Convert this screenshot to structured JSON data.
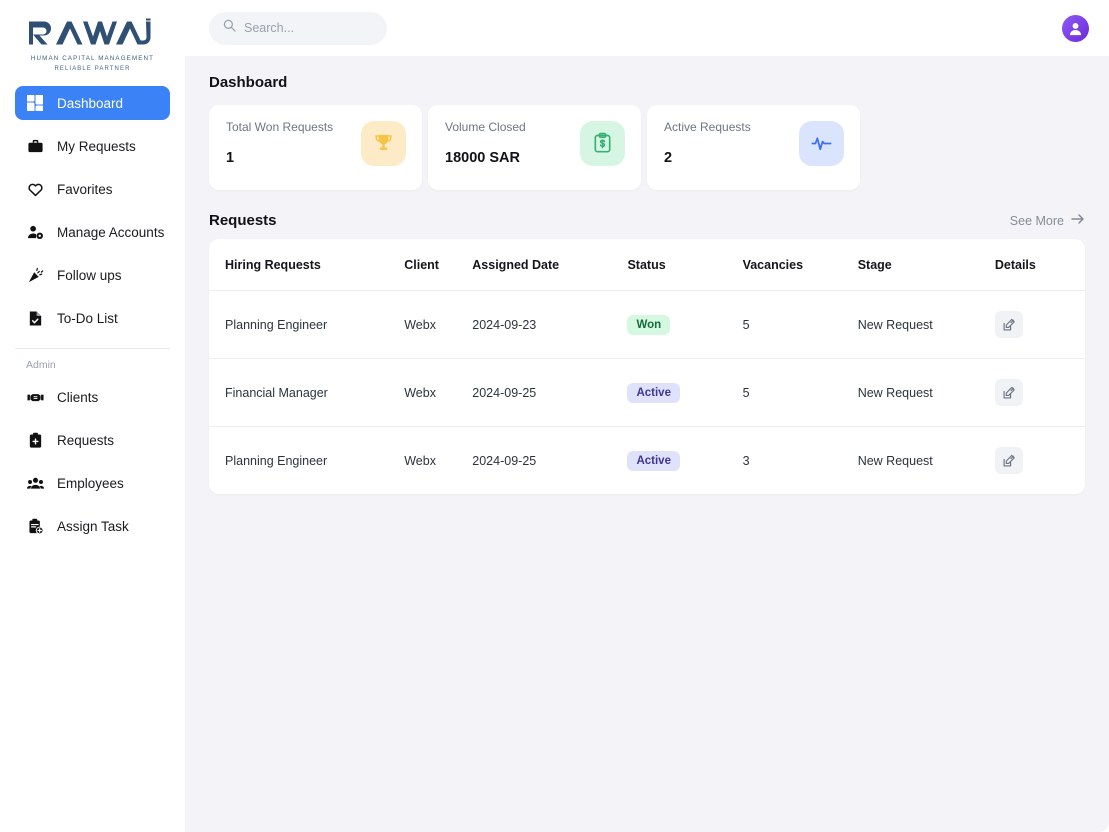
{
  "brand": {
    "name": "RAWAJ",
    "tagline_1": "HUMAN CAPITAL MANAGEMENT",
    "tagline_2": "RELIABLE PARTNER",
    "logo_color": "#2f4f73"
  },
  "topbar": {
    "search_placeholder": "Search...",
    "search_value": "",
    "search_icon": "search-icon",
    "avatar_icon": "user-avatar-icon",
    "avatar_color": "#7c3aed"
  },
  "sidebar": {
    "items": [
      {
        "label": "Dashboard",
        "icon": "dashboard-grid-icon",
        "active": true
      },
      {
        "label": "My Requests",
        "icon": "briefcase-icon",
        "active": false
      },
      {
        "label": "Favorites",
        "icon": "heart-icon",
        "active": false
      },
      {
        "label": "Manage Accounts",
        "icon": "user-settings-icon",
        "active": false
      },
      {
        "label": "Follow ups",
        "icon": "party-popper-icon",
        "active": false
      },
      {
        "label": "To-Do List",
        "icon": "document-check-icon",
        "active": false
      }
    ],
    "section_label": "Admin",
    "admin_items": [
      {
        "label": "Clients",
        "icon": "handshake-icon"
      },
      {
        "label": "Requests",
        "icon": "clipboard-plus-icon"
      },
      {
        "label": "Employees",
        "icon": "users-group-icon"
      },
      {
        "label": "Assign Task",
        "icon": "clipboard-assign-icon"
      }
    ],
    "active_color": "#3b82f6"
  },
  "main": {
    "page_title": "Dashboard",
    "stats": [
      {
        "label": "Total Won Requests",
        "value": "1",
        "icon": "trophy-icon",
        "icon_bg": "#fdebc8"
      },
      {
        "label": "Volume Closed",
        "value": "18000 SAR",
        "icon": "clipboard-dollar-icon",
        "icon_bg": "#d6f5e2"
      },
      {
        "label": "Active Requests",
        "value": "2",
        "icon": "activity-pulse-icon",
        "icon_bg": "#dbe4fd"
      }
    ],
    "requests": {
      "title": "Requests",
      "see_more_label": "See More",
      "see_more_icon": "arrow-right-icon",
      "columns": [
        "Hiring Requests",
        "Client",
        "Assigned Date",
        "Status",
        "Vacancies",
        "Stage",
        "Details"
      ],
      "rows": [
        {
          "hiring_request": "Planning Engineer",
          "client": "Webx",
          "assigned_date": "2024-09-23",
          "status": "Won",
          "status_type": "won",
          "vacancies": "5",
          "stage": "New Request",
          "details_icon": "edit-icon"
        },
        {
          "hiring_request": "Financial Manager",
          "client": "Webx",
          "assigned_date": "2024-09-25",
          "status": "Active",
          "status_type": "active",
          "vacancies": "5",
          "stage": "New Request",
          "details_icon": "edit-icon"
        },
        {
          "hiring_request": "Planning Engineer",
          "client": "Webx",
          "assigned_date": "2024-09-25",
          "status": "Active",
          "status_type": "active",
          "vacancies": "3",
          "stage": "New Request",
          "details_icon": "edit-icon"
        }
      ]
    }
  }
}
